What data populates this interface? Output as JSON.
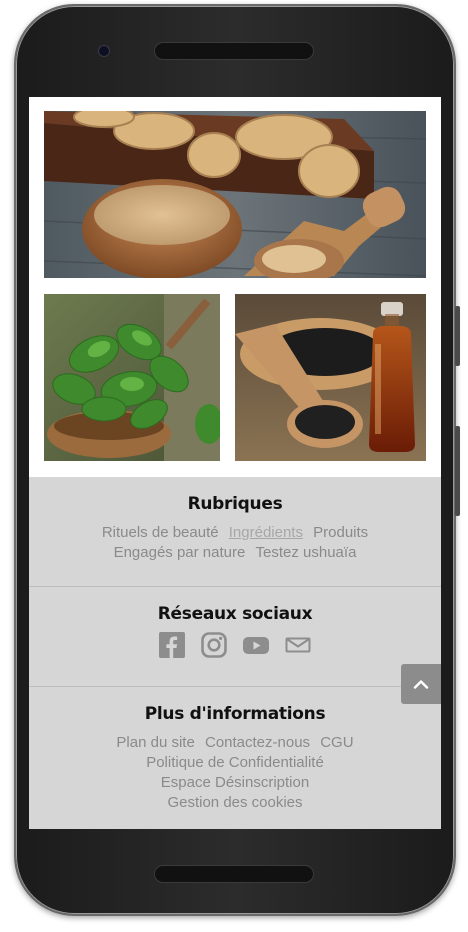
{
  "gallery": {
    "top_image": "ginger-powder-photo",
    "bottom_left_image": "mint-leaves-photo",
    "bottom_right_image": "black-seeds-oil-photo"
  },
  "footer": {
    "rubriques": {
      "title": "Rubriques",
      "links": [
        "Rituels de beauté",
        "Ingrédients",
        "Produits",
        "Engagés par nature",
        "Testez ushuaïa"
      ],
      "active_link": "Ingrédients"
    },
    "social": {
      "title": "Réseaux sociaux",
      "icons": [
        "facebook-icon",
        "instagram-icon",
        "youtube-icon",
        "mail-icon"
      ]
    },
    "info": {
      "title": "Plus d'informations",
      "links": [
        "Plan du site",
        "Contactez-nous",
        "CGU",
        "Politique de Confidentialité",
        "Espace Désinscription",
        "Gestion des cookies"
      ]
    }
  },
  "colors": {
    "footer_bg": "#d6d6d6",
    "link_text": "#8a8a8a",
    "heading_text": "#111111",
    "scroll_button": "#8c8c8c",
    "phone_body": "#262626"
  },
  "scroll_top_icon": "chevron-up-icon"
}
